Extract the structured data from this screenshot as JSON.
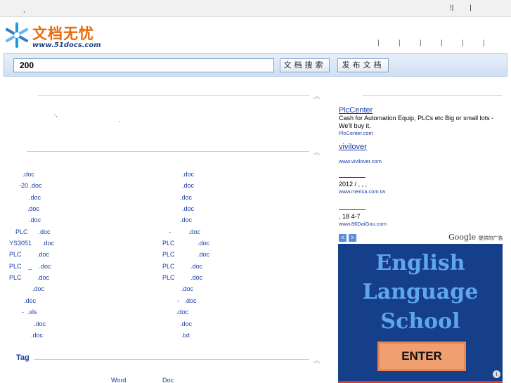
{
  "topbar": {
    "left_sep": ",",
    "right_links": [
      "!|",
      "|"
    ]
  },
  "logo": {
    "name": "文档无忧",
    "url": "www.51docs.com"
  },
  "nav": {
    "separators": [
      "|",
      "|",
      "|",
      "|",
      "|",
      ".",
      "|"
    ]
  },
  "search": {
    "value": "200",
    "search_label": "文档搜索",
    "publish_label": "发布文档"
  },
  "intro": {
    "frag1": "-,",
    "frag2": ","
  },
  "docs_left": [
    ".doc",
    "-20 .doc",
    ".doc",
    ".doc",
    ".doc",
    "PLC      .doc",
    "YS3051      .doc",
    "PLC         .doc",
    "PLC    _    .doc",
    "PLC         .doc",
    ".doc",
    ".doc",
    "-  .xls",
    ".doc",
    ".doc"
  ],
  "docs_right": [
    ".doc",
    ".doc",
    ".doc",
    ".doc",
    ".doc",
    "-          .doc",
    "PLC             .doc",
    "PLC             .doc",
    "PLC         .doc",
    "PLC         .doc",
    ".doc",
    "-   .doc",
    ".doc",
    ".doc",
    ".txt"
  ],
  "tags": {
    "title": "Tag",
    "links": [
      "Word",
      "Doc"
    ]
  },
  "ads": [
    {
      "title": "PlcCenter",
      "desc": "Cash for Automation Equip, PLCs etc Big or small lots - We'll buy it.",
      "url": "PlcCenter.com"
    },
    {
      "title": "vivilover",
      "desc": "",
      "url": "www.vivilover.com"
    },
    {
      "title": "",
      "desc": "2012 /    ,    ,    ,",
      "url": "www.merica.com.tw"
    },
    {
      "title": "",
      "desc": ",          18   4-7",
      "url": "www.86DaiGou.com"
    }
  ],
  "ad_footer": {
    "google": "Google",
    "provided": "提供的广告",
    "prev_icon": "<",
    "next_icon": ">"
  },
  "banner": {
    "lines": [
      "English",
      "Language",
      "School"
    ],
    "button": "ENTER",
    "info": "i"
  },
  "colors": {
    "link": "#1a3ca8",
    "logo_orange": "#e56b0a",
    "banner_bg": "#163f8a",
    "banner_text": "#5fa6ec",
    "button": "#f0a070"
  }
}
